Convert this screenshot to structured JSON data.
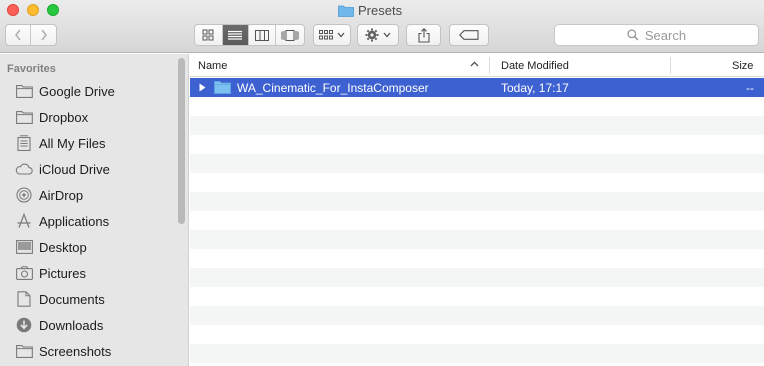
{
  "window": {
    "title": "Presets"
  },
  "toolbar": {
    "search_placeholder": "Search"
  },
  "sidebar": {
    "section": "Favorites",
    "items": [
      {
        "label": "Google Drive",
        "icon": "folder-icon"
      },
      {
        "label": "Dropbox",
        "icon": "folder-icon"
      },
      {
        "label": "All My Files",
        "icon": "all-files-icon"
      },
      {
        "label": "iCloud Drive",
        "icon": "cloud-icon"
      },
      {
        "label": "AirDrop",
        "icon": "airdrop-icon"
      },
      {
        "label": "Applications",
        "icon": "applications-icon"
      },
      {
        "label": "Desktop",
        "icon": "desktop-icon"
      },
      {
        "label": "Pictures",
        "icon": "camera-icon"
      },
      {
        "label": "Documents",
        "icon": "documents-icon"
      },
      {
        "label": "Downloads",
        "icon": "download-icon"
      },
      {
        "label": "Screenshots",
        "icon": "folder-icon"
      }
    ]
  },
  "list": {
    "columns": {
      "name": "Name",
      "date": "Date Modified",
      "size": "Size"
    },
    "rows": [
      {
        "name": "WA_Cinematic_For_InstaComposer",
        "date": "Today, 17:17",
        "size": "--"
      }
    ]
  },
  "colors": {
    "selection": "#3d61d0",
    "folder": "#5fb2ea"
  }
}
